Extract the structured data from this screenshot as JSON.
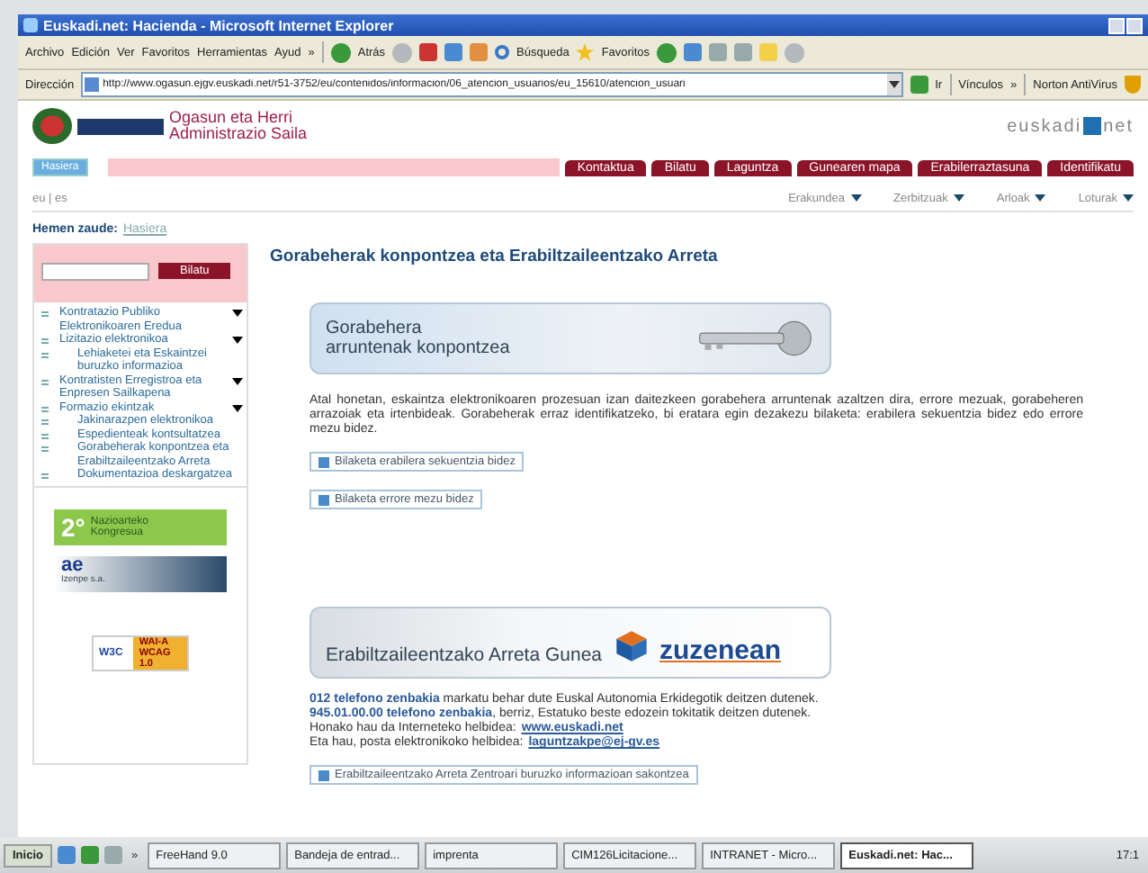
{
  "window": {
    "title": "Euskadi.net: Hacienda - Microsoft Internet Explorer"
  },
  "menu": [
    "Archivo",
    "Edición",
    "Ver",
    "Favoritos",
    "Herramientas",
    "Ayud",
    "»"
  ],
  "toolbar": {
    "back": "Atrás",
    "search": "Búsqueda",
    "favorites": "Favoritos"
  },
  "address_bar": {
    "label": "Dirección",
    "url": "http://www.ogasun.ejgv.euskadi.net/r51-3752/eu/contenidos/informacion/06_atencion_usuarios/eu_15610/atencion_usuari",
    "go": "Ir",
    "links": "Vínculos",
    "more": "»",
    "norton": "Norton AntiVirus"
  },
  "site": {
    "department": [
      "Ogasun eta Herri",
      "Administrazio Saila"
    ],
    "brand": [
      "euskadi",
      "net"
    ],
    "home": "Hasiera",
    "nav": [
      "Kontaktua",
      "Bilatu",
      "Laguntza",
      "Gunearen mapa",
      "Erabilerraztasuna",
      "Identifikatu"
    ],
    "languages": "eu | es",
    "subnav": [
      "Erakundea",
      "Zerbitzuak",
      "Arloak",
      "Loturak"
    ],
    "breadcrumb": {
      "label": "Hemen zaude:",
      "link": "Hasiera"
    }
  },
  "sidebar": {
    "search_button": "Bilatu",
    "items": [
      {
        "label": "Kontratazio Publiko Elektronikoaren Eredua",
        "has_submenu": true
      },
      {
        "label": "Lizitazio elektronikoa",
        "has_submenu": true
      },
      {
        "label": "Lehiaketei eta Eskaintzei buruzko informazioa",
        "has_submenu": false
      },
      {
        "label": "Kontratisten Erregistroa eta Enpresen Sailkapena",
        "has_submenu": true
      },
      {
        "label": "Formazio ekintzak",
        "has_submenu": true
      },
      {
        "label": "Jakinarazpen elektronikoa",
        "has_submenu": false
      },
      {
        "label": "Espedienteak kontsultatzea",
        "has_submenu": false
      },
      {
        "label": "Gorabeherak konpontzea eta Erabiltzaileentzako Arreta",
        "has_submenu": false
      },
      {
        "label": "Dokumentazioa deskargatzea",
        "has_submenu": false
      }
    ],
    "badges": [
      {
        "kind": "congress",
        "text": [
          "2°",
          "Nazioarteko",
          "Kongresua"
        ]
      },
      {
        "kind": "izenpe",
        "text": [
          "ae",
          "Izenpe s.a."
        ]
      },
      {
        "kind": "w3c",
        "text": [
          "W3C",
          "WAI-A",
          "WCAG 1.0"
        ]
      }
    ]
  },
  "main": {
    "title": "Gorabeherak konpontzea eta Erabiltzaileentzako Arreta",
    "banner_1": [
      "Gorabehera",
      "arruntenak konpontzea"
    ],
    "paragraph": "Atal honetan, eskaintza elektronikoaren prozesuan izan daitezkeen gorabehera arruntenak azaltzen dira, errore mezuak, gorabeheren arrazoiak eta irtenbideak. Gorabeherak erraz identifikatzeko, bi eratara egin dezakezu bilaketa: erabilera sekuentzia bidez edo errore mezu bidez.",
    "links": [
      "Bilaketa erabilera sekuentzia bidez",
      "Bilaketa errore mezu bidez"
    ],
    "banner_2": {
      "text": "Erabiltzaileentzako Arreta Gunea",
      "logo": "zuzenean"
    },
    "info": [
      {
        "text": "**012 telefono zenbakia** markatu behar dute Euskal Autonomia Erkidegotik deitzen dutenek."
      },
      {
        "text": "**945.01.00.00 telefono zenbakia**, berriz, Estatuko beste edozein tokitatik deitzen dutenek."
      },
      {
        "text": "Honako hau da Interneteko helbidea:",
        "link": "www.euskadi.net"
      },
      {
        "text": "Eta hau, posta elektronikoko helbidea:",
        "link": "laguntzakpe@ej-gv.es"
      }
    ],
    "bottom_link": "Erabiltzaileentzako Arreta Zentroari buruzko informazioan sakontzea"
  },
  "taskbar": {
    "start": "Inicio",
    "more": "»",
    "items": [
      {
        "label": "FreeHand 9.0",
        "selected": false
      },
      {
        "label": "Bandeja de entrad...",
        "selected": false
      },
      {
        "label": "imprenta",
        "selected": false
      },
      {
        "label": "CIM126Licitacione...",
        "selected": false
      },
      {
        "label": "INTRANET - Micro...",
        "selected": false
      },
      {
        "label": "Euskadi.net: Hac...",
        "selected": true
      }
    ],
    "clock": "17:1"
  }
}
